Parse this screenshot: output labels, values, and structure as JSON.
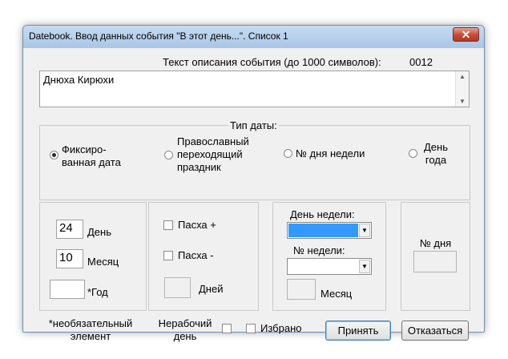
{
  "window": {
    "title": "Datebook.  Ввод данных события \"В этот день...\".  Список 1",
    "close_glyph": "✕"
  },
  "description": {
    "label": "Текст описания события (до 1000 символов):",
    "counter": "0012",
    "value": "Днюха Кирюхи"
  },
  "date_type": {
    "legend": "Тип даты:",
    "options": [
      {
        "label_lines": [
          "Фиксиро-",
          "ванная дата"
        ],
        "checked": true
      },
      {
        "label_lines": [
          "Православный",
          "переходящий",
          "праздник"
        ],
        "checked": false
      },
      {
        "label_lines": [
          "№ дня недели"
        ],
        "checked": false
      },
      {
        "label_lines": [
          "День",
          "года"
        ],
        "checked": false
      }
    ]
  },
  "fixed": {
    "day_value": "24",
    "day_label": "День",
    "month_value": "10",
    "month_label": "Месяц",
    "year_value": "",
    "year_label": "*Год"
  },
  "easter": {
    "plus_label": "Пасха +",
    "minus_label": "Пасха -",
    "days_label": "Дней"
  },
  "weekday": {
    "weekday_label": "День недели:",
    "week_number_label": "№ недели:",
    "month_label": "Месяц"
  },
  "day_of_year": {
    "label": "№ дня"
  },
  "footer": {
    "note_lines": [
      "*необязательный",
      "элемент"
    ],
    "nonworking_lines": [
      "Нерабочий",
      "день"
    ],
    "favorite_label": "Избрано",
    "accept_label": "Принять",
    "cancel_label": "Отказаться"
  },
  "colors": {
    "selection": "#3399ff"
  }
}
